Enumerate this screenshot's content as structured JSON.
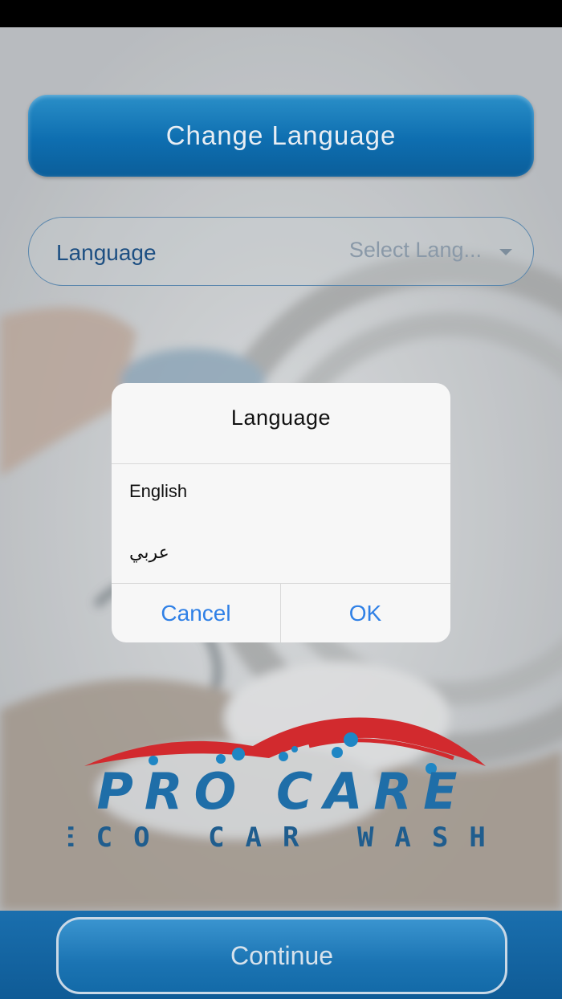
{
  "header": {
    "title": "Change Language"
  },
  "language_field": {
    "label": "Language",
    "placeholder": "Select Lang..."
  },
  "logo": {
    "brand": "PRO CARE",
    "tagline": "ECO CAR WASH"
  },
  "footer": {
    "continue_label": "Continue"
  },
  "dialog": {
    "title": "Language",
    "options": [
      {
        "label": "English"
      },
      {
        "label": "عربي"
      }
    ],
    "cancel_label": "Cancel",
    "ok_label": "OK"
  },
  "colors": {
    "accent_blue": "#0e6eb0",
    "dialog_button": "#2f80e6",
    "logo_red": "#d22a2e",
    "logo_blue": "#1f6ea8"
  }
}
